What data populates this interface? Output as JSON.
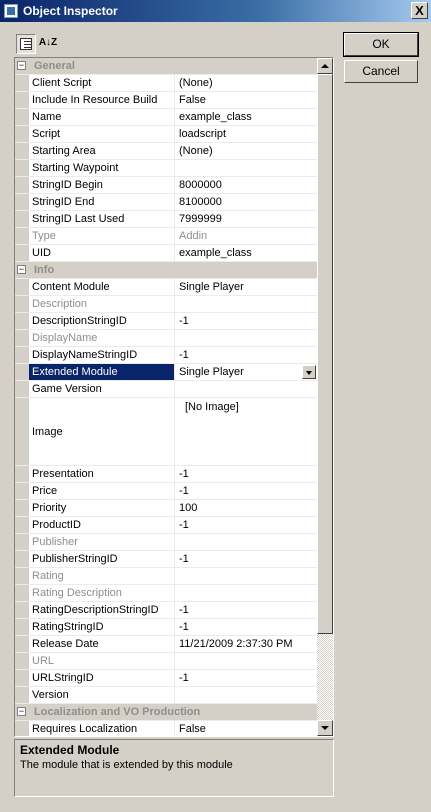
{
  "window": {
    "title": "Object Inspector",
    "close_label": "X"
  },
  "toolbar": {
    "categorized_icon": "categorized-icon",
    "alphabetical_label": "A↓Z"
  },
  "buttons": {
    "ok": "OK",
    "cancel": "Cancel"
  },
  "grid": {
    "rows": [
      {
        "type": "category",
        "label": "General",
        "toggle": "−"
      },
      {
        "name": "Client Script",
        "value": "(None)"
      },
      {
        "name": "Include In Resource Build",
        "value": "False"
      },
      {
        "name": "Name",
        "value": "example_class"
      },
      {
        "name": "Script",
        "value": "loadscript"
      },
      {
        "name": "Starting Area",
        "value": "(None)"
      },
      {
        "name": "Starting Waypoint",
        "value": ""
      },
      {
        "name": "StringID Begin",
        "value": "8000000"
      },
      {
        "name": "StringID End",
        "value": "8100000"
      },
      {
        "name": "StringID Last Used",
        "value": "7999999"
      },
      {
        "name": "Type",
        "value": "Addin",
        "readonly": true
      },
      {
        "name": "UID",
        "value": "example_class"
      },
      {
        "type": "category",
        "label": "Info",
        "toggle": "−"
      },
      {
        "name": "Content Module",
        "value": "Single Player"
      },
      {
        "name": "Description",
        "value": "",
        "readonly": true
      },
      {
        "name": "DescriptionStringID",
        "value": "-1"
      },
      {
        "name": "DisplayName",
        "value": "",
        "readonly": true
      },
      {
        "name": "DisplayNameStringID",
        "value": "-1"
      },
      {
        "name": "Extended Module",
        "value": "Single Player",
        "selected": true
      },
      {
        "name": "Game Version",
        "value": ""
      },
      {
        "name": "Image",
        "value": "[No Image]",
        "tall": true
      },
      {
        "name": "Presentation",
        "value": "-1"
      },
      {
        "name": "Price",
        "value": "-1"
      },
      {
        "name": "Priority",
        "value": "100"
      },
      {
        "name": "ProductID",
        "value": "-1"
      },
      {
        "name": "Publisher",
        "value": "",
        "readonly": true
      },
      {
        "name": "PublisherStringID",
        "value": "-1"
      },
      {
        "name": "Rating",
        "value": "",
        "readonly": true
      },
      {
        "name": "Rating Description",
        "value": "",
        "readonly": true
      },
      {
        "name": "RatingDescriptionStringID",
        "value": "-1"
      },
      {
        "name": "RatingStringID",
        "value": "-1"
      },
      {
        "name": "Release Date",
        "value": "11/21/2009 2:37:30 PM"
      },
      {
        "name": "URL",
        "value": "",
        "readonly": true
      },
      {
        "name": "URLStringID",
        "value": "-1"
      },
      {
        "name": "Version",
        "value": ""
      },
      {
        "type": "category",
        "label": "Localization and VO Production",
        "toggle": "−"
      },
      {
        "name": "Requires Localization",
        "value": "False"
      }
    ]
  },
  "description": {
    "title": "Extended Module",
    "text": "The module that is extended by this module"
  }
}
